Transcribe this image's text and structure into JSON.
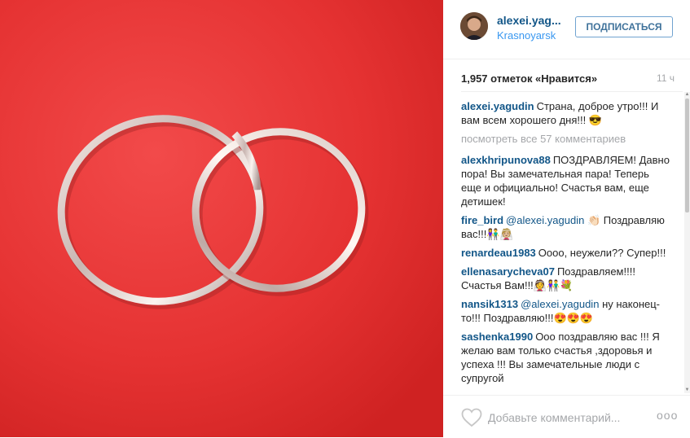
{
  "post": {
    "username": "alexei.yag...",
    "location": "Krasnoyarsk",
    "follow_label": "ПОДПИСАТЬСЯ",
    "likes": "1,957 отметок «Нравится»",
    "time": "11 ч"
  },
  "caption": {
    "author": "alexei.yagudin",
    "text": "Страна, доброе утро!!! И вам всем хорошего дня!!! 😎"
  },
  "view_all": "посмотреть все 57 комментариев",
  "comments": [
    {
      "author": "alexkhripunova88",
      "mention": "",
      "text": "ПОЗДРАВЛЯЕМ! Давно пора! Вы замечательная пара! Теперь еще и официально! Счастья вам, еще детишек!"
    },
    {
      "author": "fire_bird",
      "mention": "@alexei.yagudin",
      "text": "👏🏻 Поздравляю вас!!!👫👰🏼"
    },
    {
      "author": "renardeau1983",
      "mention": "",
      "text": "Оооо, неужели?? Супер!!!"
    },
    {
      "author": "ellenasarycheva07",
      "mention": "",
      "text": "Поздравляем!!!! Счастья Вам!!!👰👫💐"
    },
    {
      "author": "nansik1313",
      "mention": "@alexei.yagudin",
      "text": "ну наконец-то!!! Поздравляю!!!😍😍😍"
    },
    {
      "author": "sashenka1990",
      "mention": "",
      "text": "Ооо поздравляю вас !!! Я желаю вам только счастья ,здоровья и успеха !!! Вы замечательные люди с супругой"
    }
  ],
  "footer": {
    "add_comment_placeholder": "Добавьте комментарий...",
    "more_label": "ooo"
  },
  "colors": {
    "photo_red": "#e73333",
    "link_blue": "#125688",
    "follow_blue": "#3f729b",
    "muted_gray": "#a5a7aa"
  }
}
